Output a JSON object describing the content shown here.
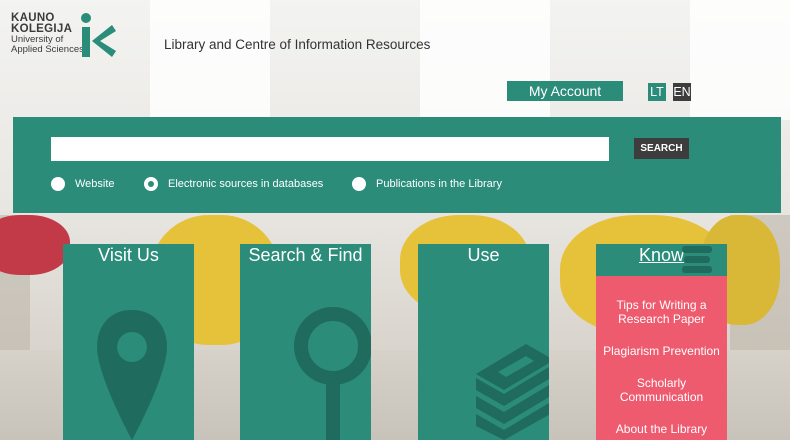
{
  "header": {
    "logo_line1": "KAUNO",
    "logo_line2": "KOLEGIJA",
    "logo_line3": "University of",
    "logo_line4": "Applied Sciences",
    "site_title": "Library and Centre of Information Resources",
    "account_label": "My Account",
    "lang_lt": "LT",
    "lang_en": "EN"
  },
  "search": {
    "input_value": "",
    "button_label": "SEARCH",
    "options": [
      {
        "label": "Website",
        "selected": false
      },
      {
        "label": "Electronic sources in databases",
        "selected": true
      },
      {
        "label": "Publications in the Library",
        "selected": false
      }
    ]
  },
  "tiles": [
    {
      "title": "Visit Us",
      "icon": "map-pin-icon"
    },
    {
      "title": "Search & Find",
      "icon": "magnifier-icon"
    },
    {
      "title": "Use",
      "icon": "books-icon"
    },
    {
      "title": "Know",
      "icon": "stack-icon"
    }
  ],
  "know_menu": [
    "Tips for Writing a Research Paper",
    "Plagiarism Prevention",
    "Scholarly Communication",
    "About the Library"
  ],
  "colors": {
    "accent": "#2a8c79",
    "dark": "#3d3d3d",
    "menu": "#ee5a6e"
  }
}
